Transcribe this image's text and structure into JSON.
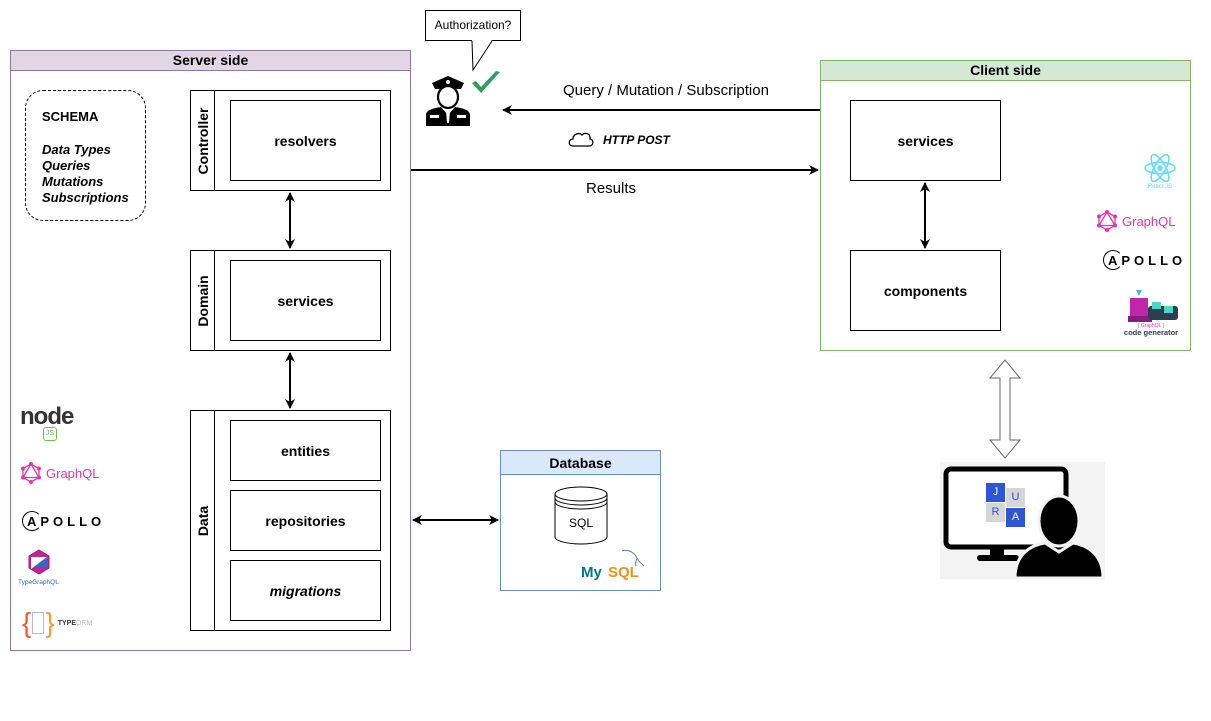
{
  "server": {
    "title": "Server side",
    "schema": {
      "title": "SCHEMA",
      "items": [
        "Data Types",
        "Queries",
        "Mutations",
        "Subscriptions"
      ]
    },
    "layers": {
      "controller": {
        "label": "Controller",
        "boxes": [
          "resolvers"
        ]
      },
      "domain": {
        "label": "Domain",
        "boxes": [
          "services"
        ]
      },
      "data": {
        "label": "Data",
        "boxes": [
          "entities",
          "repositories",
          "migrations"
        ]
      }
    },
    "logos": {
      "node": "node",
      "node_sub": "JS",
      "graphql": "GraphQL",
      "apollo": "APOLLO",
      "typegraphql": "TypeGraphQL",
      "typeorm_a": "TYPE",
      "typeorm_b": "ORM"
    }
  },
  "client": {
    "title": "Client side",
    "boxes": [
      "services",
      "components"
    ],
    "logos": {
      "react": "React JS",
      "graphql": "GraphQL",
      "apollo": "APOLLO",
      "codegen_top": "[ GraphQL ]",
      "codegen": "code generator"
    }
  },
  "database": {
    "title": "Database",
    "cylinder": "SQL",
    "logo": {
      "my": "My",
      "sql": "SQL"
    }
  },
  "auth": {
    "bubble": "Authorization?"
  },
  "connections": {
    "request": "Query  / Mutation  / Subscription",
    "protocol": "HTTP POST",
    "response": "Results"
  },
  "user": {
    "tiles": [
      "J",
      "U",
      "R",
      "A"
    ]
  },
  "colors": {
    "server_border": "#9673a6",
    "server_fill": "#e1d5e7",
    "client_border": "#82b366",
    "client_fill": "#d5e8d4",
    "db_border": "#6c8ebf",
    "db_fill": "#dae8fc",
    "check": "#2e9e5e",
    "graphql": "#e535ab",
    "react": "#61dafb",
    "jura_blue": "#2f55d4",
    "jura_grey": "#d6d6d6"
  }
}
